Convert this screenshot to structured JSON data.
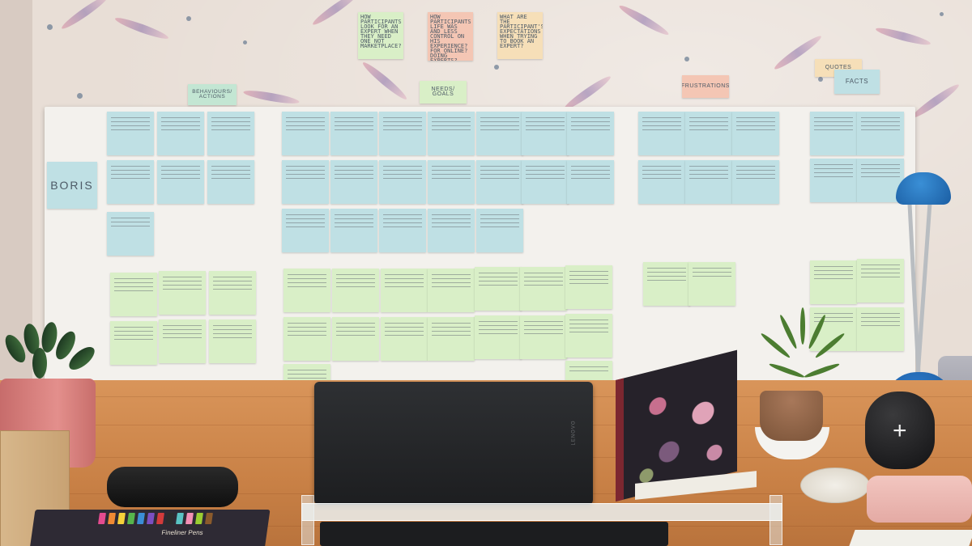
{
  "scene": {
    "board_labels": {
      "boris": "BORIS",
      "behaviours": "BEHAVIOURS/ ACTIONS",
      "needs": "NEEDS/ GOALS",
      "frustrations": "FRUSTRATIONS",
      "quotes": "QUOTES",
      "facts": "FACTS"
    },
    "top_questions": [
      "HOW PARTICIPANTS LOOK FOR AN EXPERT WHEN THEY NEED ONE NOT MARKETPLACE?",
      "HOW PARTICIPANTS LIFE WAS AND LESS CONTROL ON HIS EXPERIENCE? FOR ONLINE? DOING EXPERTS?",
      "WHAT ARE THE PARTICIPANT'S EXPECTATIONS WHEN TRYING TO BOOK AN EXPERT?"
    ],
    "laptop_brand": "LENOVO",
    "pen_box_label": "Fineliner Pens",
    "colors": {
      "wall": "#e8ded6",
      "board": "#f3f1ed",
      "note_green": "#c3e6d3",
      "note_blue": "#bfe0e4",
      "note_yellow": "#d9efc7",
      "note_pink": "#f4c6b4",
      "desk": "#d9955a",
      "lamp": "#2f7ed0"
    }
  }
}
